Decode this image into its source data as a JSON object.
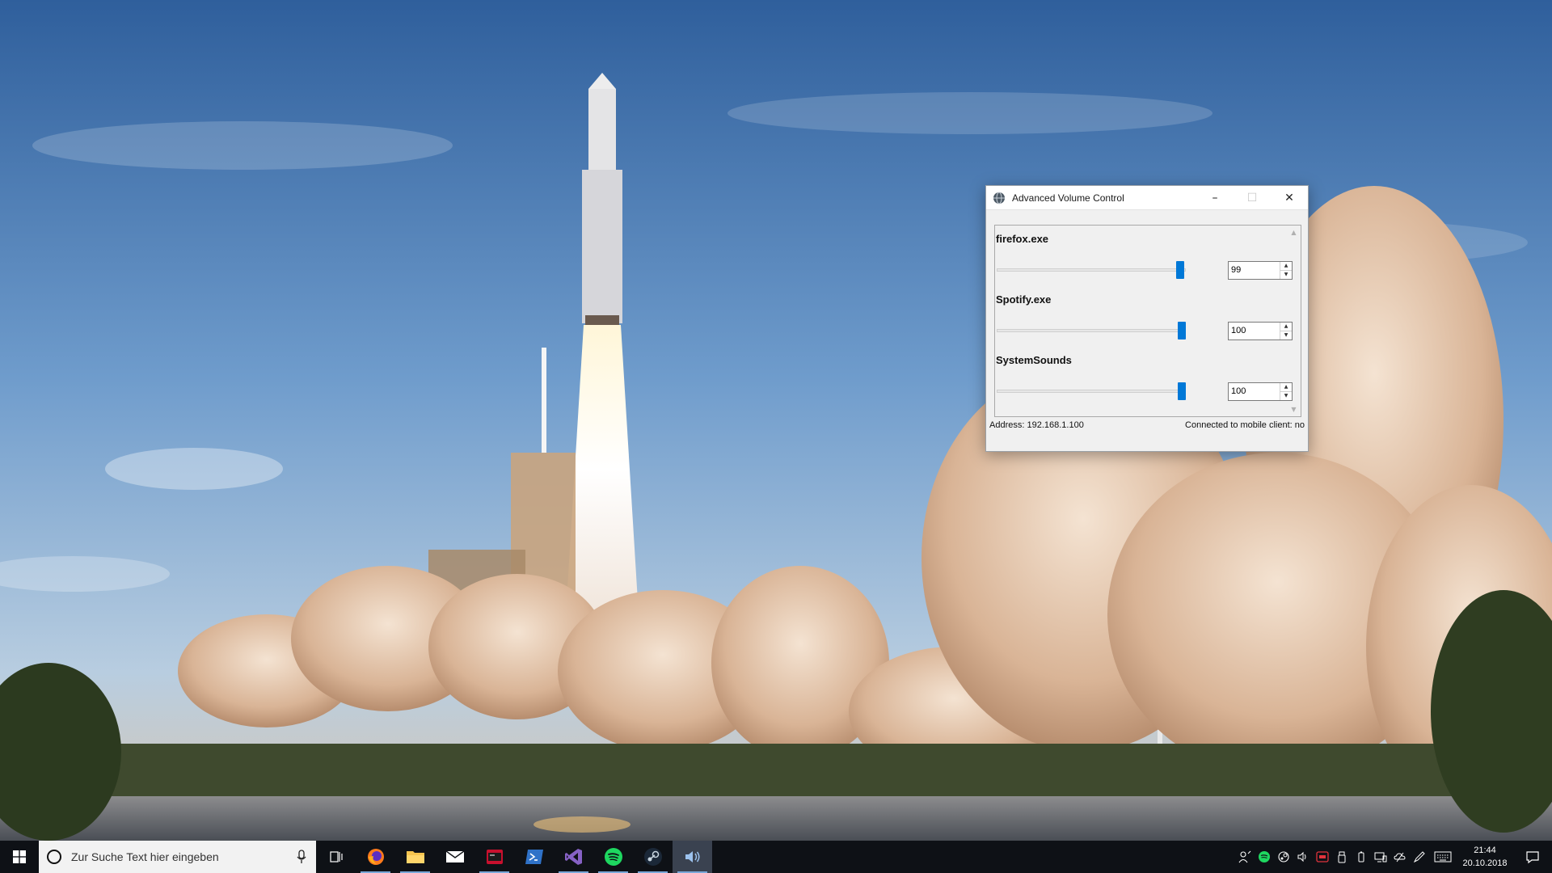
{
  "window": {
    "title": "Advanced Volume Control",
    "minimize_glyph": "–",
    "maximize_glyph": "☐",
    "close_glyph": "✕",
    "accent_color": "#0078d7",
    "apps": [
      {
        "name": "firefox.exe",
        "volume": "99",
        "level_percent": 99
      },
      {
        "name": "Spotify.exe",
        "volume": "100",
        "level_percent": 100
      },
      {
        "name": "SystemSounds",
        "volume": "100",
        "level_percent": 100
      }
    ],
    "status": {
      "address": "Address: 192.168.1.100",
      "connection": "Connected to mobile client: no"
    }
  },
  "taskbar": {
    "search_placeholder": "Zur Suche Text hier eingeben",
    "pinned_icons": [
      "task-view-icon",
      "firefox-icon",
      "file-explorer-icon",
      "mail-icon",
      "terminal-icon",
      "powershell-icon",
      "visual-studio-icon",
      "spotify-icon",
      "steam-icon",
      "speaker-app-icon"
    ],
    "clock": {
      "time": "21:44",
      "date": "20.10.2018"
    }
  }
}
